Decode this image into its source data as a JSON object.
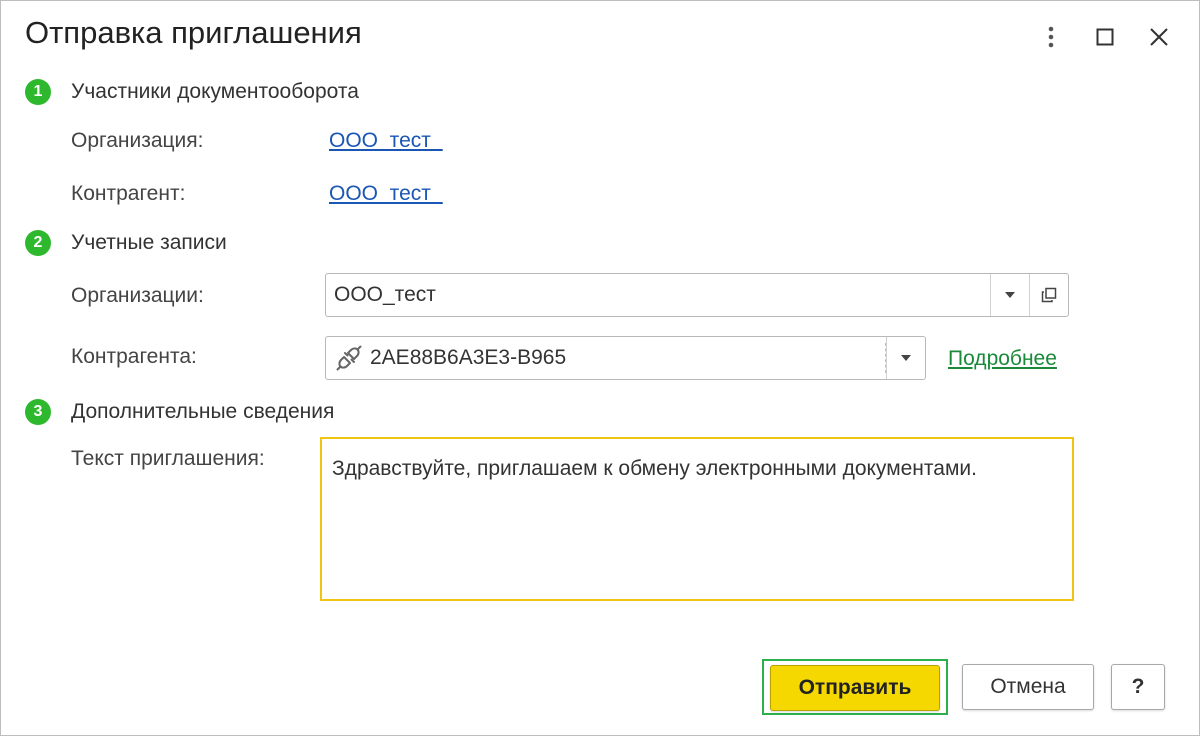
{
  "window": {
    "title": "Отправка приглашения"
  },
  "sections": {
    "participants": {
      "number": "1",
      "title": "Участники документооборота",
      "organization_label": "Организация:",
      "organization_value": "ООО_тест_",
      "counterparty_label": "Контрагент:",
      "counterparty_value": "ООО_тест_"
    },
    "accounts": {
      "number": "2",
      "title": "Учетные записи",
      "organizations_label": "Организации:",
      "organizations_value": "ООО_тест",
      "counterparty_label": "Контрагента:",
      "counterparty_value": "2AE88B6A3E3-B965",
      "details_link": "Подробнее"
    },
    "additional": {
      "number": "3",
      "title": "Дополнительные сведения",
      "invitation_label": "Текст приглашения:",
      "invitation_text": "Здравствуйте, приглашаем к обмену электронными документами."
    }
  },
  "buttons": {
    "send": "Отправить",
    "cancel": "Отмена",
    "help": "?"
  },
  "icons": {
    "more": "more-vertical-icon",
    "maximize": "maximize-icon",
    "close": "close-icon",
    "dropdown": "chevron-down-icon",
    "open": "open-form-icon",
    "plug": "plug-icon"
  },
  "colors": {
    "badge": "#2eb82e",
    "link": "#1a56b4",
    "link_green": "#1a8a3a",
    "send_button": "#f5d800",
    "focus_border": "#f1c40f",
    "default_button_frame": "#2db04b"
  }
}
